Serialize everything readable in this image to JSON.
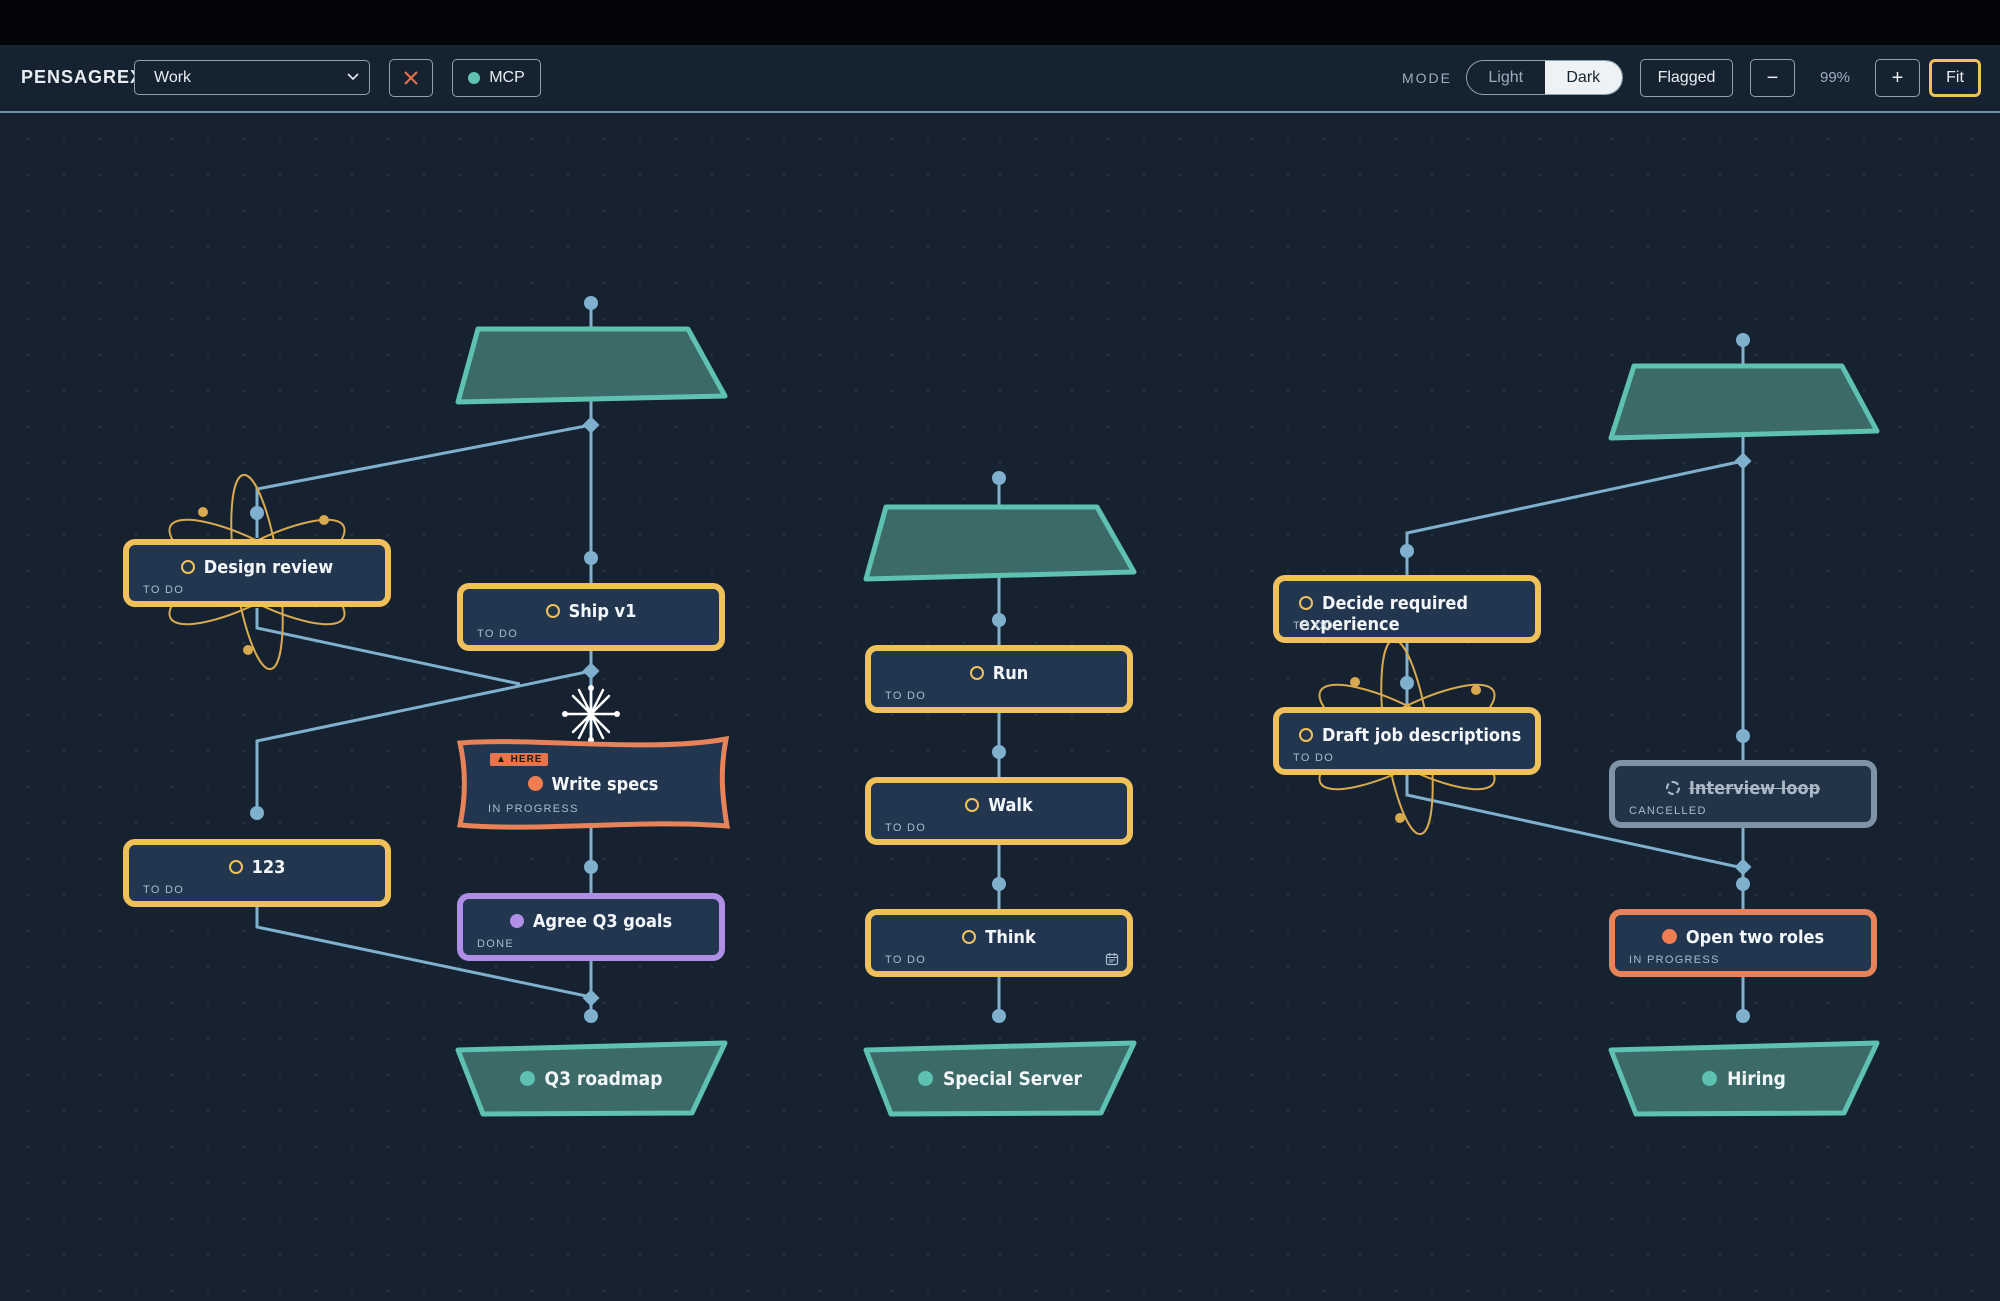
{
  "toolbar": {
    "brand": "PENSAGREX",
    "workspace": "Work",
    "mcp_label": "MCP",
    "mode_label": "MODE",
    "mode_light": "Light",
    "mode_dark": "Dark",
    "flagged_label": "Flagged",
    "zoom_out": "−",
    "zoom_level": "99%",
    "zoom_in": "+",
    "fit_label": "Fit"
  },
  "here_badge": "▲ HERE",
  "tasks": {
    "design_review": {
      "title": "Design review",
      "status": "TO DO"
    },
    "ship_v1": {
      "title": "Ship v1",
      "status": "TO DO"
    },
    "write_specs": {
      "title": "Write specs",
      "status": "IN PROGRESS"
    },
    "task_123": {
      "title": "123",
      "status": "TO DO"
    },
    "agree_q3": {
      "title": "Agree Q3 goals",
      "status": "DONE"
    },
    "run": {
      "title": "Run",
      "status": "TO DO"
    },
    "walk": {
      "title": "Walk",
      "status": "TO DO"
    },
    "think": {
      "title": "Think",
      "status": "TO DO"
    },
    "decide_exp": {
      "title": "Decide required experience",
      "status": "TO DO"
    },
    "draft_jd": {
      "title": "Draft job descriptions",
      "status": "TO DO"
    },
    "interview_loop": {
      "title": "Interview loop",
      "status": "CANCELLED"
    },
    "open_roles": {
      "title": "Open two roles",
      "status": "IN PROGRESS"
    }
  },
  "goals": {
    "q3": "Q3 roadmap",
    "special": "Special Server",
    "hiring": "Hiring"
  },
  "colors": {
    "todo": "#f0c05a",
    "done": "#b08ee6",
    "in_progress": "#e88258",
    "cancelled": "#7e93a5",
    "goal": "#5fc1b0",
    "edge": "#7fb0cd"
  }
}
